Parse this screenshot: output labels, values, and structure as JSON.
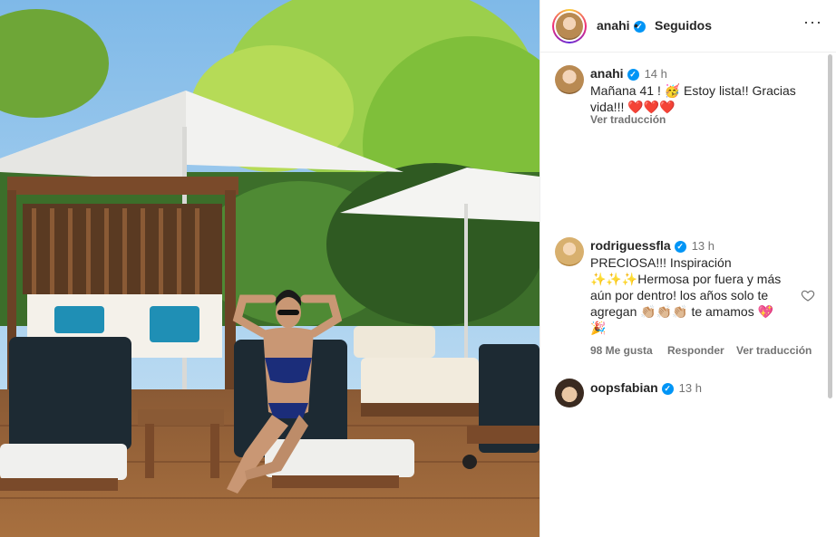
{
  "post": {
    "author": "anahi",
    "follow_status": "Seguidos",
    "separator": "•",
    "more": "···"
  },
  "caption": {
    "username": "anahi",
    "time": "14 h",
    "text_line1": "Mañana 41 ! 🥳 Estoy lista!! Gracias",
    "text_line2": "vida!!! ❤️❤️❤️",
    "translate": "Ver traducción"
  },
  "comments": [
    {
      "username": "rodriguessfla",
      "time": "13 h",
      "line1": "PRECIOSA!!! Inspiración",
      "line2": "✨✨✨Hermosa por fuera y más",
      "line3": "aún por dentro! los años solo te",
      "line4": "agregan 👏🏼👏🏼👏🏼 te amamos 💖",
      "line5": "🎉",
      "likes": "98 Me gusta",
      "reply": "Responder",
      "translate": "Ver traducción"
    },
    {
      "username": "oopsfabian",
      "time": "13 h"
    }
  ],
  "icons": {
    "verified": "verified-badge-icon",
    "like": "heart-icon",
    "more": "more-options-icon"
  },
  "colors": {
    "verified": "#0095f6",
    "muted": "#737373",
    "text": "#262626"
  }
}
